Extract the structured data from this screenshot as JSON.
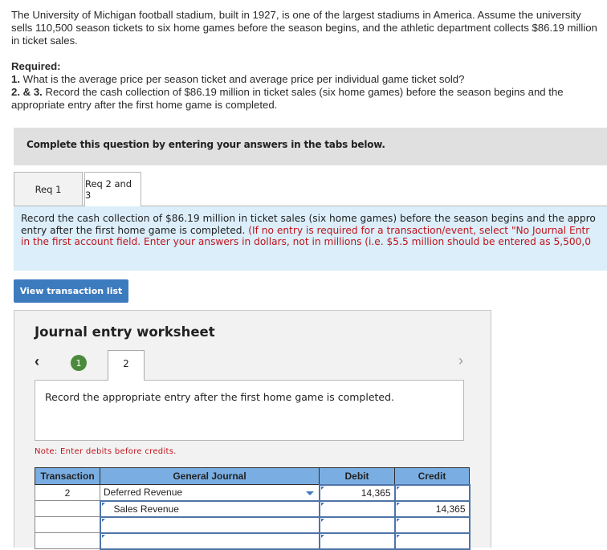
{
  "problem": {
    "paragraph": "The University of Michigan football stadium, built in 1927, is one of the largest stadiums in America. Assume the university sells 110,500 season tickets to six home games before the season begins, and the athletic department collects $86.19 million in ticket sales.",
    "required_label": "Required:",
    "items": [
      {
        "num": "1.",
        "text": " What is the average price per season ticket and average price per individual game ticket sold?"
      },
      {
        "num": "2. & 3.",
        "text": " Record the cash collection of $86.19 million in ticket sales (six home games) before the season begins and the appropriate entry after the first home game is completed."
      }
    ]
  },
  "banner": "Complete this question by entering your answers in the tabs below.",
  "tabs": [
    {
      "label": "Req 1",
      "active": false
    },
    {
      "label": "Req 2 and 3",
      "active": true
    }
  ],
  "instructions": {
    "line1": "Record the cash collection of $86.19 million in ticket sales (six home games) before the season begins and the appro",
    "line2_black": "entry after the first home game is completed. ",
    "line2_red": "(If no entry is required for a transaction/event, select \"No Journal Entr",
    "line3_red": "in the first account field. Enter your answers in dollars, not in millions (i.e. $5.5 million should be entered as 5,500,0"
  },
  "view_transaction_button": "View transaction list",
  "worksheet": {
    "title": "Journal entry worksheet",
    "steps": [
      {
        "label": "1",
        "completed": true
      },
      {
        "label": "2",
        "current": true
      }
    ],
    "description": "Record the appropriate entry after the first home game is completed.",
    "note": "Note: Enter debits before credits.",
    "columns": [
      "Transaction",
      "General Journal",
      "Debit",
      "Credit"
    ],
    "rows": [
      {
        "transaction": "2",
        "account": "Deferred Revenue",
        "debit": "14,365",
        "credit": ""
      },
      {
        "transaction": "",
        "account": "Sales Revenue",
        "debit": "",
        "credit": "14,365"
      },
      {
        "transaction": "",
        "account": "",
        "debit": "",
        "credit": ""
      },
      {
        "transaction": "",
        "account": "",
        "debit": "",
        "credit": ""
      }
    ]
  },
  "colors": {
    "accent_blue": "#3d7bbf",
    "header_blue": "#7aaee2",
    "instruction_bg": "#dbeefa",
    "error_red": "#c0141b",
    "step_complete_green": "#4a8a3c"
  }
}
